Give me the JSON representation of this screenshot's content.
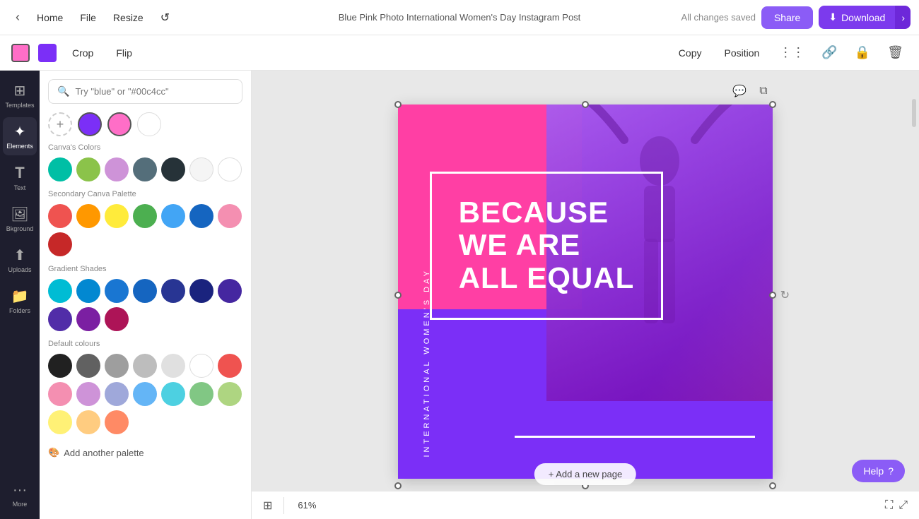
{
  "topbar": {
    "home_label": "Home",
    "file_label": "File",
    "resize_label": "Resize",
    "save_status": "All changes saved",
    "title": "Blue Pink Photo International Women's Day Instagram Post",
    "share_label": "Share",
    "download_label": "Download"
  },
  "toolbar": {
    "color1": "#ff6ec7",
    "color2": "#7b2ff7",
    "crop_label": "Crop",
    "flip_label": "Flip",
    "copy_label": "Copy",
    "position_label": "Position"
  },
  "sidebar": {
    "items": [
      {
        "id": "templates",
        "label": "Templates",
        "icon": "⊞"
      },
      {
        "id": "elements",
        "label": "Elements",
        "icon": "✦"
      },
      {
        "id": "text",
        "label": "Text",
        "icon": "T"
      },
      {
        "id": "background",
        "label": "Bkground",
        "icon": "🖼"
      },
      {
        "id": "uploads",
        "label": "Uploads",
        "icon": "↑"
      },
      {
        "id": "folders",
        "label": "Folders",
        "icon": "📁"
      },
      {
        "id": "more",
        "label": "More",
        "icon": "···"
      }
    ]
  },
  "color_panel": {
    "search_placeholder": "Try \"blue\" or \"#00c4cc\"",
    "selected_colors": [
      "#ff6ec7",
      "#7b2ff7",
      "#ffffff"
    ],
    "canva_colors_title": "Canva's Colors",
    "canva_colors": [
      "#00bfa5",
      "#8bc34a",
      "#ce93d8",
      "#546e7a",
      "#263238",
      "#f5f5f5",
      "#ffffff"
    ],
    "secondary_palette_title": "Secondary Canva Palette",
    "secondary_colors": [
      "#ef5350",
      "#ff9800",
      "#ffeb3b",
      "#4caf50",
      "#42a5f5",
      "#1565c0",
      "#f48fb1",
      "#c62828"
    ],
    "gradient_shades_title": "Gradient Shades",
    "gradient_colors": [
      "#00bcd4",
      "#0288d1",
      "#1976d2",
      "#1565c0",
      "#283593",
      "#1a237e",
      "#4527a0",
      "#512da8",
      "#7b1fa2",
      "#ad1457"
    ],
    "default_colours_title": "Default colours",
    "default_colors": [
      "#212121",
      "#616161",
      "#9e9e9e",
      "#bdbdbd",
      "#e0e0e0",
      "#ffffff",
      "#ef5350",
      "#f48fb1",
      "#ce93d8",
      "#9fa8da",
      "#64b5f6",
      "#4dd0e1",
      "#81c784",
      "#aed581",
      "#fff176",
      "#ffcc80",
      "#ff8a65"
    ],
    "add_palette_label": "Add another palette"
  },
  "canvas": {
    "main_text_line1": "BECAUSE",
    "main_text_line2": "WE ARE",
    "main_text_line3": "ALL EQUAL",
    "vertical_text": "INTERNATIONAL WOMEN'S DAY",
    "zoom_level": "61%",
    "add_page_label": "+ Add a new page"
  },
  "help": {
    "label": "Help",
    "icon": "?"
  }
}
